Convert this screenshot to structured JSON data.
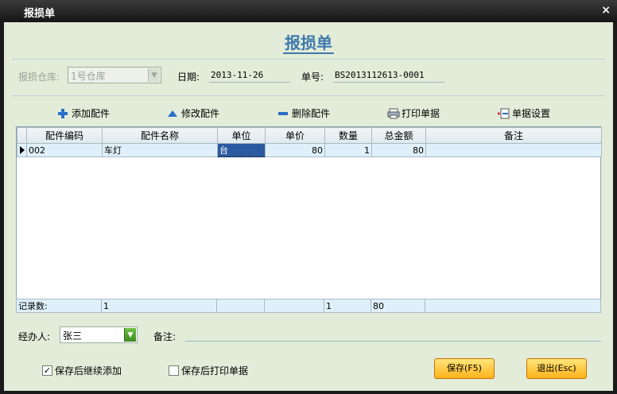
{
  "window": {
    "title": "报损单",
    "close_glyph": "×"
  },
  "heading": "报损单",
  "header": {
    "warehouse_label": "报损仓库:",
    "warehouse_value": "1号仓库",
    "date_label": "日期:",
    "date_value": "2013-11-26",
    "number_label": "单号:",
    "number_value": "BS2013112613-0001"
  },
  "toolbar": {
    "add": "添加配件",
    "edit": "修改配件",
    "delete": "删除配件",
    "print": "打印单据",
    "settings": "单据设置"
  },
  "table": {
    "columns": [
      "配件编码",
      "配件名称",
      "单位",
      "单价",
      "数量",
      "总金额",
      "备注"
    ],
    "rows": [
      {
        "code": "002",
        "name": "车灯",
        "unit": "台",
        "price": "80",
        "qty": "1",
        "amount": "80",
        "note": ""
      }
    ],
    "footer": {
      "label": "记录数:",
      "count": "1",
      "qty_total": "1",
      "amount_total": "80"
    }
  },
  "bottom": {
    "handler_label": "经办人:",
    "handler_value": "张三",
    "remark_label": "备注:",
    "continue_add_label": "保存后继续添加",
    "continue_add_checked": true,
    "print_after_save_label": "保存后打印单据",
    "print_after_save_checked": false,
    "save_button": "保存(F5)",
    "exit_button": "退出(Esc)"
  },
  "colors": {
    "accent": "#3e79ad",
    "panel": "#e3ecd8",
    "button": "#ffc83a",
    "selected": "#2c5aa0"
  },
  "icons": [
    "plus-icon",
    "triangle-up-icon",
    "minus-icon",
    "printer-icon",
    "settings-icon",
    "row-pointer-icon",
    "chevron-down-icon"
  ]
}
